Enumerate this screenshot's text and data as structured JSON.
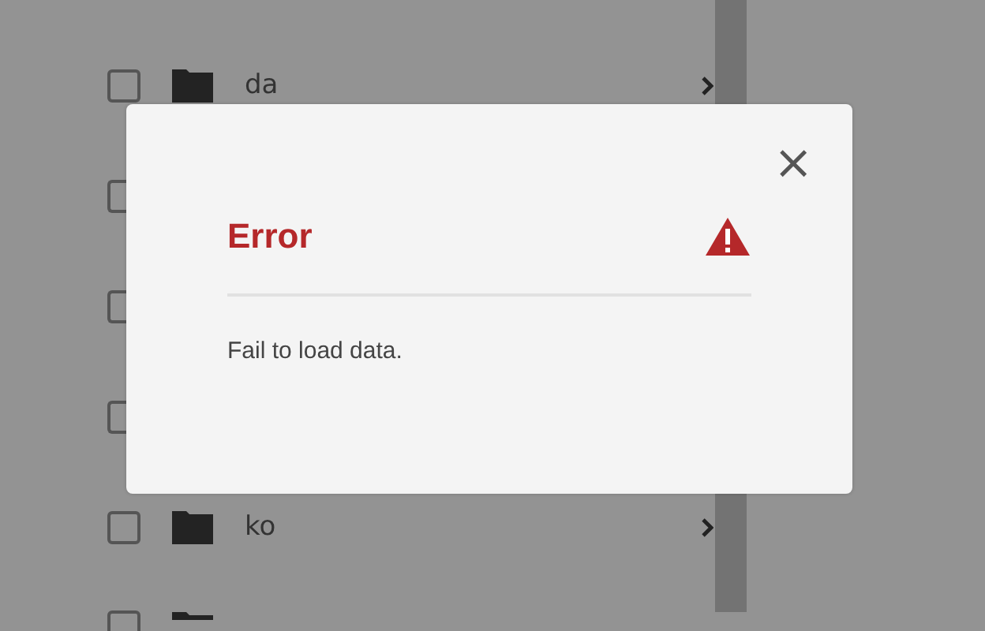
{
  "folders": [
    {
      "kind": "full",
      "name": "da",
      "checked": false
    },
    {
      "kind": "covered",
      "checked": false
    },
    {
      "kind": "covered",
      "checked": false
    },
    {
      "kind": "covered",
      "checked": false
    },
    {
      "kind": "full",
      "name": "ko",
      "checked": false
    },
    {
      "kind": "cut",
      "checked": false
    }
  ],
  "dialog": {
    "title": "Error",
    "message": "Fail to load data.",
    "close": "×"
  }
}
